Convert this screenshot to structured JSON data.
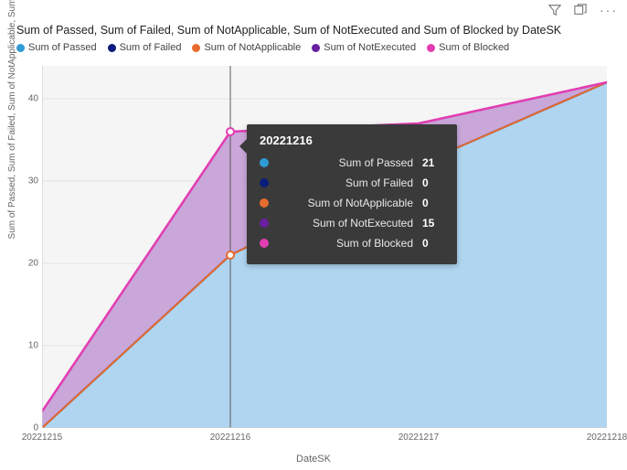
{
  "title": "Sum of Passed, Sum of Failed, Sum of NotApplicable, Sum of NotExecuted and Sum of Blocked by DateSK",
  "xlabel": "DateSK",
  "ylabel": "Sum of Passed, Sum of Failed, Sum of NotApplicable, Sum of NotExec...",
  "legend": [
    {
      "name": "Sum of Passed",
      "color": "#2e9bd6"
    },
    {
      "name": "Sum of Failed",
      "color": "#0a1d7a"
    },
    {
      "name": "Sum of NotApplicable",
      "color": "#e66b2e"
    },
    {
      "name": "Sum of NotExecuted",
      "color": "#6b1fa0"
    },
    {
      "name": "Sum of Blocked",
      "color": "#e23db2"
    }
  ],
  "tooltip": {
    "header": "20221216",
    "rows": [
      {
        "label": "Sum of Passed",
        "value": "21",
        "color": "#2e9bd6"
      },
      {
        "label": "Sum of Failed",
        "value": "0",
        "color": "#0a1d7a"
      },
      {
        "label": "Sum of NotApplicable",
        "value": "0",
        "color": "#e66b2e"
      },
      {
        "label": "Sum of NotExecuted",
        "value": "15",
        "color": "#6b1fa0"
      },
      {
        "label": "Sum of Blocked",
        "value": "0",
        "color": "#e23db2"
      }
    ]
  },
  "chart_data": {
    "type": "area",
    "xlabel": "DateSK",
    "ylabel": "Sum of Passed, Sum of Failed, Sum of NotApplicable, Sum of NotExecuted and Sum of Blocked",
    "ylim": [
      0,
      44
    ],
    "yticks": [
      0,
      10,
      20,
      30,
      40
    ],
    "categories": [
      "20221215",
      "20221216",
      "20221217",
      "20221218"
    ],
    "series": [
      {
        "name": "Sum of Passed",
        "color": "#2e9bd6",
        "values": [
          0,
          21,
          32,
          42
        ]
      },
      {
        "name": "Sum of Failed",
        "color": "#0a1d7a",
        "values": [
          0,
          0,
          0,
          0
        ]
      },
      {
        "name": "Sum of NotApplicable",
        "color": "#e66b2e",
        "values": [
          0,
          0,
          0,
          0
        ]
      },
      {
        "name": "Sum of NotExecuted",
        "color": "#6b1fa0",
        "values": [
          2,
          15,
          5,
          0
        ]
      },
      {
        "name": "Sum of Blocked",
        "color": "#e23db2",
        "values": [
          0,
          0,
          0,
          0
        ]
      }
    ],
    "stacked": true,
    "stacked_top": [
      2,
      36,
      37,
      42
    ]
  }
}
